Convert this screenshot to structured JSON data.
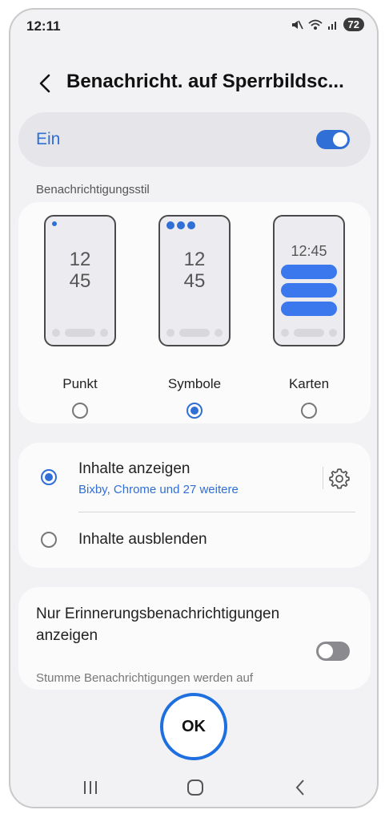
{
  "status_bar": {
    "time": "12:11",
    "battery": "72",
    "icons": [
      "mute-icon",
      "wifi-icon",
      "signal-icon"
    ]
  },
  "header": {
    "title": "Benachricht. auf Sperrbildsc..."
  },
  "main_toggle": {
    "label": "Ein",
    "state": "on"
  },
  "style_section": {
    "title": "Benachrichtigungsstil",
    "options": [
      {
        "label": "Punkt",
        "clock": [
          "12",
          "45"
        ],
        "selected": false
      },
      {
        "label": "Symbole",
        "clock": [
          "12",
          "45"
        ],
        "selected": true
      },
      {
        "label": "Karten",
        "clock": [
          "12:45"
        ],
        "selected": false
      }
    ]
  },
  "content_section": {
    "show": {
      "title": "Inhalte anzeigen",
      "subtitle": "Bixby, Chrome und 27 weitere",
      "selected": true
    },
    "hide": {
      "title": "Inhalte ausblenden",
      "selected": false
    }
  },
  "reminder_section": {
    "title": "Nur Erinnerungsbenachrichtigungen anzeigen",
    "description": "Stumme Benachrichtigungen werden auf",
    "state": "off"
  },
  "ok_button": {
    "label": "OK"
  },
  "colors": {
    "accent": "#2f6fd6",
    "ok_ring": "#1e6fe0",
    "toggle_off": "#8a8a8f"
  }
}
